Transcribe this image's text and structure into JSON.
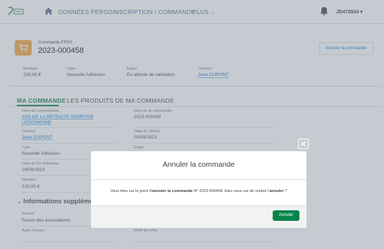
{
  "nav": {
    "items": [
      {
        "label": "DONNÉES PERSO"
      },
      {
        "label": "INSCRIPTION / COMMANDE"
      },
      {
        "label": "PLUS"
      }
    ],
    "chevron": "⌄",
    "user": "JD470934 ▾"
  },
  "header": {
    "object_label": "Commande FFRS",
    "order_number": "2023-000458",
    "cancel_label": "Annuler la commande",
    "fields": [
      {
        "label": "Montant",
        "value": "230,00 €"
      },
      {
        "label": "Type",
        "value": "Nouvelle Adhésion"
      },
      {
        "label": "Étape",
        "value": "En attente de validation"
      },
      {
        "label": "Contact",
        "value": "Jean DUPONT"
      }
    ]
  },
  "tabs": [
    {
      "label": "MA COMMANDE"
    },
    {
      "label": "LES PRODUITS DE MA COMMANDE"
    }
  ],
  "details": {
    "left": [
      {
        "label": "Nom de l'organisation",
        "value": "ASS DE LA RETRAITE SPORTIVE LEDONIENNE"
      },
      {
        "label": "Contact",
        "value": "Jean DUPONT"
      },
      {
        "label": "Type",
        "value": "Nouvelle Adhésion"
      },
      {
        "label": "Date de Fin Adhésion",
        "value": "18/09/2023"
      },
      {
        "label": "Montant",
        "value": "230,00 €"
      }
    ],
    "right": [
      {
        "label": "Nom de la commande",
        "value": "2023-000458"
      },
      {
        "label": "Date de clôture",
        "value": "05/09/2023"
      },
      {
        "label": "Étape",
        "value": ""
      }
    ],
    "section_title": "Informations supplémentaires",
    "source_label": "Source",
    "source_value": "Forum des associations",
    "autre_source_label": "Autre Source",
    "motif_label": "Motif de refus"
  },
  "modal": {
    "title": "Annuler la commande",
    "body_prefix": "Vous êtes sur le point d'",
    "body_bold1": "annuler la commande",
    "body_mid": " N° 2023-000458. Etes vous sur de vouloir l'",
    "body_bold2": "annuler",
    "body_suffix": " ?",
    "confirm_label": "Annuler"
  },
  "colors": {
    "accent_green": "#04844b",
    "tab_green": "#0b7a3e",
    "link_blue": "#0070d2",
    "order_icon": "#f2a23b"
  }
}
